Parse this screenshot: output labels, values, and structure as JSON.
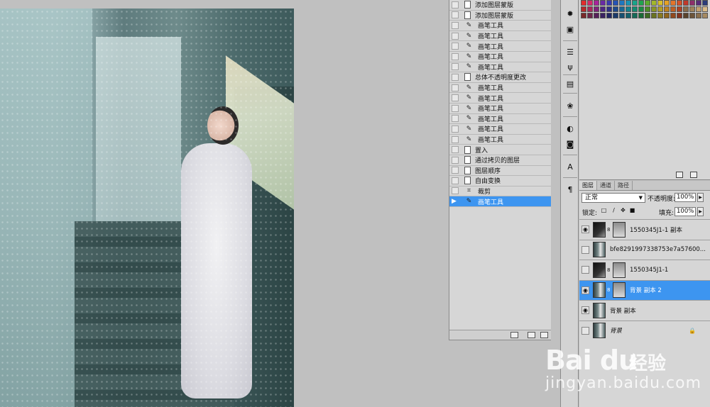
{
  "history": {
    "items": [
      {
        "label": "添加图层蒙版",
        "icon": "document-icon"
      },
      {
        "label": "添加图层蒙版",
        "icon": "document-icon"
      },
      {
        "label": "画笔工具",
        "icon": "brush-icon"
      },
      {
        "label": "画笔工具",
        "icon": "brush-icon"
      },
      {
        "label": "画笔工具",
        "icon": "brush-icon"
      },
      {
        "label": "画笔工具",
        "icon": "brush-icon"
      },
      {
        "label": "画笔工具",
        "icon": "brush-icon"
      },
      {
        "label": "总体不透明度更改",
        "icon": "document-icon"
      },
      {
        "label": "画笔工具",
        "icon": "brush-icon"
      },
      {
        "label": "画笔工具",
        "icon": "brush-icon"
      },
      {
        "label": "画笔工具",
        "icon": "brush-icon"
      },
      {
        "label": "画笔工具",
        "icon": "brush-icon"
      },
      {
        "label": "画笔工具",
        "icon": "brush-icon"
      },
      {
        "label": "画笔工具",
        "icon": "brush-icon"
      },
      {
        "label": "置入",
        "icon": "document-icon"
      },
      {
        "label": "通过拷贝的图层",
        "icon": "document-icon"
      },
      {
        "label": "图层顺序",
        "icon": "document-icon"
      },
      {
        "label": "自由变换",
        "icon": "document-icon"
      },
      {
        "label": "裁剪",
        "icon": "crop-icon"
      },
      {
        "label": "画笔工具",
        "icon": "brush-icon",
        "active": true
      }
    ]
  },
  "layers": {
    "tabs": [
      "图层",
      "通道",
      "路径"
    ],
    "blend_mode": "正常",
    "opacity_label": "不透明度:",
    "opacity_value": "100%",
    "lock_label": "锁定:",
    "fill_label": "填充:",
    "fill_value": "100%",
    "rows": [
      {
        "name": "1550345J1-1 副本",
        "visible": true,
        "has_mask": true,
        "thumb": "dark"
      },
      {
        "name": "bfe8291997338753e7a57600...",
        "visible": false,
        "has_mask": false,
        "thumb": "photo"
      },
      {
        "name": "1550345J1-1",
        "visible": false,
        "has_mask": true,
        "thumb": "dark"
      },
      {
        "name": "背景 副本 2",
        "visible": true,
        "has_mask": true,
        "thumb": "photo",
        "active": true
      },
      {
        "name": "背景 副本",
        "visible": true,
        "has_mask": false,
        "thumb": "photo"
      },
      {
        "name": "背景",
        "visible": false,
        "has_mask": false,
        "thumb": "photo",
        "italic": true,
        "locked": true
      }
    ]
  },
  "tools": [
    "sun-icon",
    "image-icon",
    "sliders-icon",
    "usb-icon",
    "clipboard-icon",
    "palette-icon",
    "circle-half-icon",
    "square-circle-icon",
    "text-a-icon",
    "pilcrow-icon"
  ],
  "swatch_colors": [
    "#e32c2c",
    "#d62b6a",
    "#a8239a",
    "#6a2aa5",
    "#3b3ab0",
    "#2553b5",
    "#1f78c0",
    "#1994b5",
    "#1aa38a",
    "#21a34f",
    "#5cab2c",
    "#a3b82c",
    "#d8c02b",
    "#e6a124",
    "#e5752a",
    "#d5512a",
    "#c0392b",
    "#8e2f6a",
    "#5a2c7a",
    "#2b3c7a",
    "#b52b2b",
    "#a82a5a",
    "#7e237a",
    "#4e2883",
    "#2e3287",
    "#1f4a8c",
    "#1a6994",
    "#16808c",
    "#168a72",
    "#1d8a44",
    "#4e8a28",
    "#8a9528",
    "#b39d26",
    "#bd8220",
    "#bd5f24",
    "#ad4224",
    "#8a6c4a",
    "#a0825a",
    "#c2a070",
    "#d9bb8a",
    "#7b2a2a",
    "#6e2849",
    "#57215a",
    "#3a2362",
    "#232764",
    "#1b3a6a",
    "#185172",
    "#15626d",
    "#156a58",
    "#1a6a37",
    "#3e6a22",
    "#6a7322",
    "#8a7a20",
    "#91651c",
    "#92491e",
    "#843420",
    "#5a432c",
    "#6e553a",
    "#8a6f4c",
    "#a68a62"
  ],
  "watermark": {
    "logo": "Bai du",
    "text": "经验",
    "url": "jingyan.baidu.com"
  }
}
